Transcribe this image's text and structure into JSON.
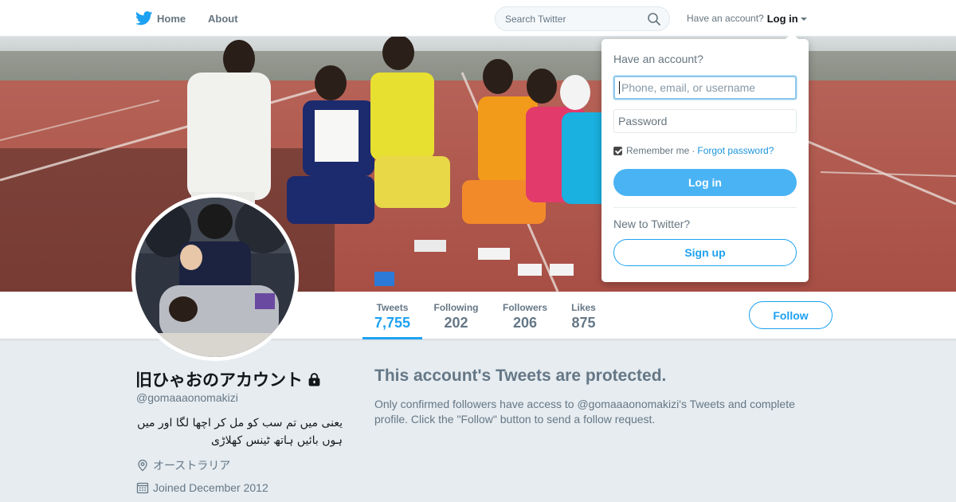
{
  "nav": {
    "home": "Home",
    "about": "About",
    "search_placeholder": "Search Twitter",
    "have_account": "Have an account?",
    "login": "Log in"
  },
  "profile": {
    "name": "旧ひゃおのアカウント",
    "handle": "@gomaaaonomakizi",
    "bio": "یعنی میں تم سب کو مل کر اچھا لگا اور میں ہوں بائیں ہاتھ ٹینس کھلاڑی",
    "location": "オーストラリア",
    "joined": "Joined December 2012"
  },
  "stats": [
    {
      "label": "Tweets",
      "value": "7,755"
    },
    {
      "label": "Following",
      "value": "202"
    },
    {
      "label": "Followers",
      "value": "206"
    },
    {
      "label": "Likes",
      "value": "875"
    }
  ],
  "follow_label": "Follow",
  "protected": {
    "title": "This account's Tweets are protected.",
    "body": "Only confirmed followers have access to @gomaaaonomakizi's Tweets and complete profile. Click the \"Follow\" button to send a follow request."
  },
  "login_dropdown": {
    "heading": "Have an account?",
    "username_placeholder": "Phone, email, or username",
    "password_placeholder": "Password",
    "remember": "Remember me",
    "separator": "·",
    "forgot": "Forgot password?",
    "login_button": "Log in",
    "new_heading": "New to Twitter?",
    "signup_button": "Sign up"
  },
  "colors": {
    "accent": "#1da1f2",
    "login_button": "#4ab3f4",
    "background": "#e6ecf0"
  }
}
